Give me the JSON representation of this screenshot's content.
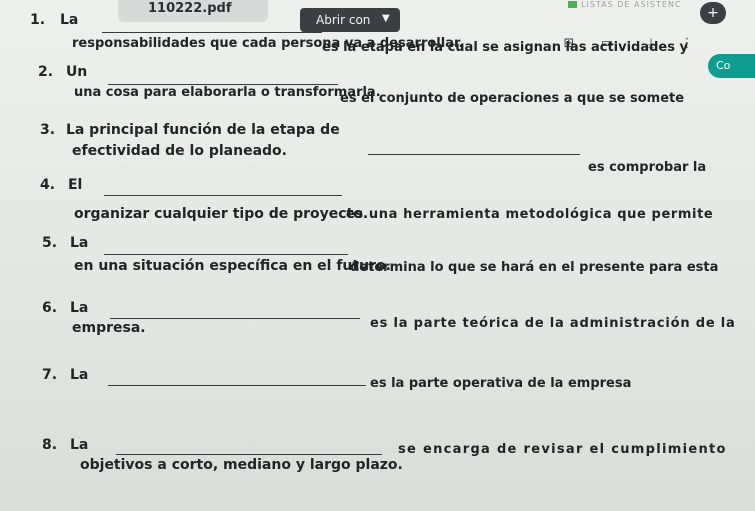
{
  "toolbar": {
    "file_name": "110222.pdf",
    "open_with": "Abrir con",
    "app_label": "LISTAS DE ASISTENC",
    "new_button": "+",
    "chip_text": "Co"
  },
  "questions": [
    {
      "num": "1.",
      "word": "La",
      "tail": "es la etapa en la cual se asignan las actividades y",
      "cont": "responsabilidades que cada persona va a desarrollar."
    },
    {
      "num": "2.",
      "word": "Un",
      "tail": "es el conjunto de operaciones a que se somete",
      "cont": "una cosa para elaborarla o transformarla."
    },
    {
      "num": "3.",
      "word": "La principal función de la etapa de",
      "tail": "es comprobar la",
      "cont": "efectividad de lo planeado."
    },
    {
      "num": "4.",
      "word": "El",
      "tail": "es una herramienta metodológica que permite",
      "cont": "organizar cualquier tipo de proyecto."
    },
    {
      "num": "5.",
      "word": "La",
      "tail": "determina lo que se hará en el presente para esta",
      "cont": "en una situación específica en el futuro."
    },
    {
      "num": "6.",
      "word": "La",
      "tail": "es la parte teórica de la administración de la",
      "cont": "empresa."
    },
    {
      "num": "7.",
      "word": "La",
      "tail": "es la parte operativa de la empresa",
      "cont": ""
    },
    {
      "num": "8.",
      "word": "La",
      "tail": "se encarga de revisar el cumplimiento",
      "cont": "objetivos a corto, mediano y largo plazo."
    }
  ]
}
